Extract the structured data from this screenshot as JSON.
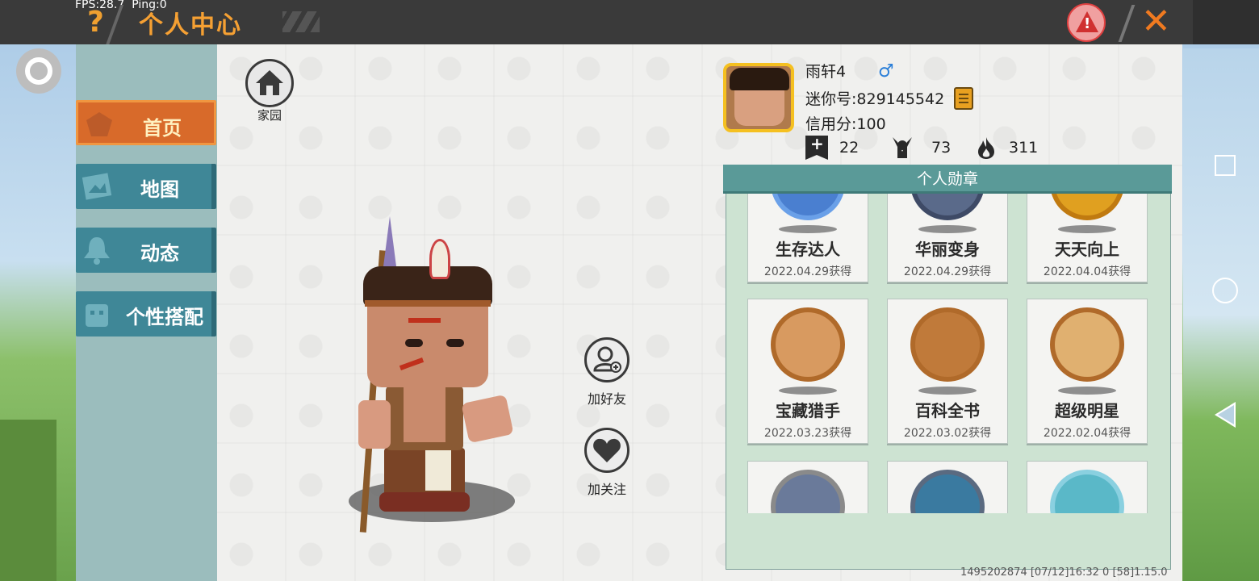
{
  "status": {
    "fps": "FPS:28.7",
    "ping": "Ping:0"
  },
  "header": {
    "help_icon": "?",
    "title": "个人中心",
    "report_icon": "!",
    "close_icon": "✕"
  },
  "nav": {
    "items": [
      {
        "label": "首页",
        "icon": "home-hanger-icon",
        "active": true
      },
      {
        "label": "地图",
        "icon": "map-icon",
        "active": false
      },
      {
        "label": "动态",
        "icon": "bell-icon",
        "active": false
      },
      {
        "label": "个性搭配",
        "icon": "outfit-icon",
        "active": false
      }
    ]
  },
  "home": {
    "label": "家园"
  },
  "actions": {
    "add_friend": "加好友",
    "follow": "加关注"
  },
  "profile": {
    "username": "雨轩4",
    "gender_icon": "♂",
    "mini_id": "迷你号:829145542",
    "credit": "信用分:100",
    "stats": [
      {
        "icon": "bookmark-plus-icon",
        "value": "22"
      },
      {
        "icon": "fans-icon",
        "value": "73"
      },
      {
        "icon": "fire-icon",
        "value": "311"
      }
    ]
  },
  "medals": {
    "title": "个人勋章",
    "items": [
      {
        "name": "生存达人",
        "date": "2022.04.29获得",
        "color": "#4a7fd0"
      },
      {
        "name": "华丽变身",
        "date": "2022.04.29获得",
        "color": "#5a6a8a"
      },
      {
        "name": "天天向上",
        "date": "2022.04.04获得",
        "color": "#e0a020"
      },
      {
        "name": "宝藏猎手",
        "date": "2022.03.23获得",
        "color": "#c88450"
      },
      {
        "name": "百科全书",
        "date": "2022.03.02获得",
        "color": "#c07a3a"
      },
      {
        "name": "超级明星",
        "date": "2022.02.04获得",
        "color": "#d8a060"
      },
      {
        "name": "",
        "date": "",
        "color": "#6a7a9a"
      },
      {
        "name": "",
        "date": "",
        "color": "#3a7aa0"
      },
      {
        "name": "",
        "date": "",
        "color": "#5ab8c8"
      }
    ]
  },
  "footer": {
    "info": "1495202874    [07/12]16:32 0    [58]1.15.0"
  },
  "colors": {
    "accent": "#f5a033",
    "nav_active": "#d86a2a",
    "nav_item": "#3f8797",
    "medal_header": "#5a9a98"
  }
}
